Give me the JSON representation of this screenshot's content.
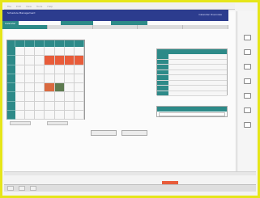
{
  "titlebar": {
    "menu": [
      "File",
      "Edit",
      "View",
      "Tools",
      "Help"
    ]
  },
  "header": {
    "title": "Schedule Management",
    "right": "Calendar Overview"
  },
  "tabs": [
    "Calendar",
    "",
    "",
    ""
  ],
  "subtabs": [
    "",
    "",
    "",
    "",
    ""
  ],
  "calendar": {
    "days": [
      "",
      "",
      "",
      "",
      "",
      "",
      "",
      ""
    ]
  },
  "cal_buttons": {
    "b1": "",
    "b2": ""
  },
  "center_buttons": {
    "b1": "",
    "b2": ""
  },
  "rpanel": {
    "title": "",
    "rows": [
      "",
      "",
      "",
      "",
      "",
      "",
      "",
      ""
    ]
  },
  "rpanel2": {
    "title": "",
    "field": ""
  },
  "status": {
    "s1": "",
    "s2": "",
    "s3": ""
  },
  "colors": {
    "accent": "#2d8a88",
    "header": "#2c3c8e",
    "highlight": "#e85c3a",
    "frame": "#e6e619"
  }
}
